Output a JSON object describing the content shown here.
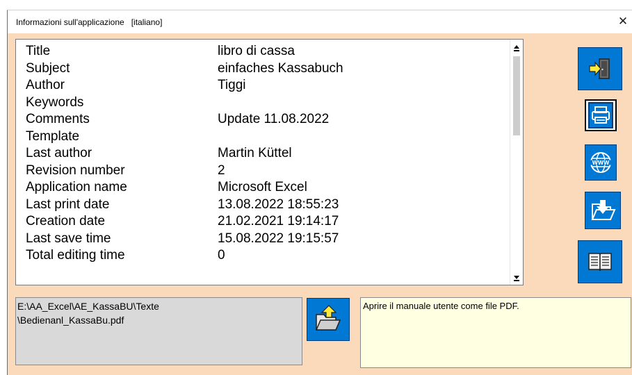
{
  "window": {
    "title": "Informazioni sull'applicazione   [italiano]",
    "close_glyph": "✕"
  },
  "properties": [
    {
      "key": "Title",
      "value": "libro di cassa"
    },
    {
      "key": "Subject",
      "value": "einfaches Kassabuch"
    },
    {
      "key": "Author",
      "value": "Tiggi"
    },
    {
      "key": "Keywords",
      "value": ""
    },
    {
      "key": "Comments",
      "value": "Update 11.08.2022"
    },
    {
      "key": "Template",
      "value": ""
    },
    {
      "key": "Last author",
      "value": "Martin Küttel"
    },
    {
      "key": "Revision number",
      "value": "2"
    },
    {
      "key": "Application name",
      "value": "Microsoft Excel"
    },
    {
      "key": "Last print date",
      "value": "13.08.2022 18:55:23"
    },
    {
      "key": "Creation date",
      "value": "21.02.2021 19:14:17"
    },
    {
      "key": "Last save time",
      "value": "15.08.2022 19:15:57"
    },
    {
      "key": "Total editing time",
      "value": "0"
    }
  ],
  "side_buttons": [
    {
      "name": "exit-button",
      "icon": "exit-door-icon"
    },
    {
      "name": "print-button",
      "icon": "printer-icon"
    },
    {
      "name": "web-button",
      "icon": "globe-www-icon"
    },
    {
      "name": "download-button",
      "icon": "folder-download-icon"
    },
    {
      "name": "manual-button",
      "icon": "open-book-icon"
    }
  ],
  "file_path": {
    "line1": "E:\\AA_Excel\\AE_KassaBU\\Texte",
    "line2": "\\Bedienanl_KassaBu.pdf"
  },
  "open_folder_icon": "folder-upload-icon",
  "info_text": "Aprire il manuale utente come file PDF.",
  "colors": {
    "dialog_bg": "#fbd9bb",
    "button_blue": "#0078d4",
    "path_box_bg": "#d9d9d9",
    "info_box_bg": "#ffffe1"
  }
}
